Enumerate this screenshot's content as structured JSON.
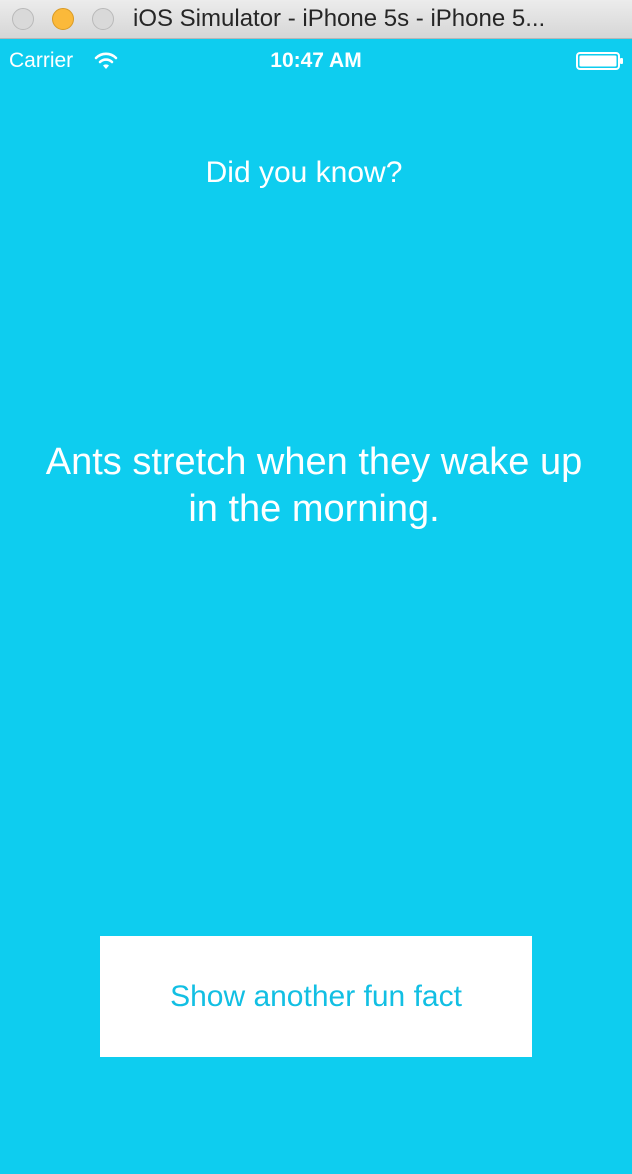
{
  "window": {
    "title": "iOS Simulator - iPhone 5s - iPhone 5..."
  },
  "status_bar": {
    "carrier": "Carrier",
    "time": "10:47 AM",
    "icons": [
      "wifi-icon",
      "battery-icon"
    ]
  },
  "main": {
    "heading": "Did you know?",
    "fact": "Ants stretch when they wake up in the morning.",
    "button_label": "Show another fun fact"
  },
  "colors": {
    "background": "#0ecdef",
    "button_background": "#ffffff",
    "button_text": "#12bfe3",
    "text": "#ffffff"
  }
}
